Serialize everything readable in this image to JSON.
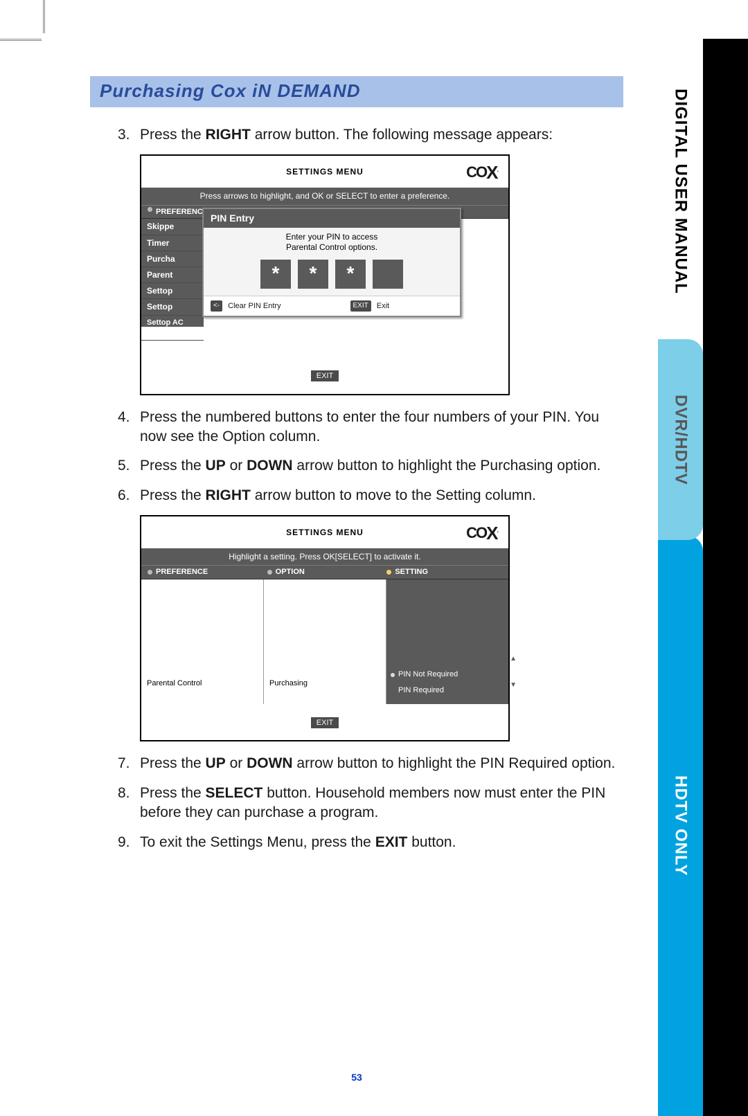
{
  "section_title": "Purchasing Cox iN DEMAND",
  "side_tabs": {
    "digital": "DIGITAL USER MANUAL",
    "dvr": "DVR/HDTV",
    "hdtv": "HDTV ONLY"
  },
  "page_number": "53",
  "logo": {
    "name": "COX"
  },
  "steps": {
    "s3": {
      "num": "3.",
      "pre": "Press the ",
      "bold": "RIGHT",
      "post": " arrow button. The following message appears:"
    },
    "s4": {
      "num": "4.",
      "text": "Press the numbered buttons to enter the four numbers of your PIN. You now see the Option column."
    },
    "s5": {
      "num": "5.",
      "pre": "Press the ",
      "bold1": "UP",
      "mid": " or ",
      "bold2": "DOWN",
      "post": " arrow button to highlight the Purchasing option."
    },
    "s6": {
      "num": "6.",
      "pre": "Press the ",
      "bold": "RIGHT",
      "post": " arrow button to move to the Setting column."
    },
    "s7": {
      "num": "7.",
      "pre": "Press the ",
      "bold1": "UP",
      "mid": " or ",
      "bold2": "DOWN",
      "post": " arrow button to highlight the PIN Required option."
    },
    "s8": {
      "num": "8.",
      "pre": "Press the ",
      "bold": "SELECT",
      "post": " button. Household members now must enter the PIN before they can purchase a program."
    },
    "s9": {
      "num": "9.",
      "pre": "To exit the Settings Menu, press the ",
      "bold": "EXIT",
      "post": " button."
    }
  },
  "figure1": {
    "settings_menu": "SETTINGS MENU",
    "instruction": "Press arrows to highlight, and OK or SELECT to enter a preference.",
    "col_preference": "PREFERENCE",
    "left_items": [
      "Skippe",
      "Timer",
      "Purcha",
      "Parent",
      "Settop",
      "Settop",
      "Settop AC Outlet"
    ],
    "pin": {
      "title": "PIN Entry",
      "line1": "Enter your PIN to access",
      "line2": "Parental Control options.",
      "stars": [
        "*",
        "*",
        "*",
        ""
      ],
      "clear_key": "<-",
      "clear_label": "Clear PIN Entry",
      "exit_key": "EXIT",
      "exit_label": "Exit"
    },
    "exit": "EXIT"
  },
  "figure2": {
    "settings_menu": "SETTINGS MENU",
    "instruction": "Highlight a setting. Press OK[SELECT] to activate it.",
    "col_preference": "PREFERENCE",
    "col_option": "OPTION",
    "col_setting": "SETTING",
    "pref_val": "Parental Control",
    "opt_val": "Purchasing",
    "setting_vals": [
      "PIN Not Required",
      "PIN Required"
    ],
    "exit": "EXIT"
  }
}
